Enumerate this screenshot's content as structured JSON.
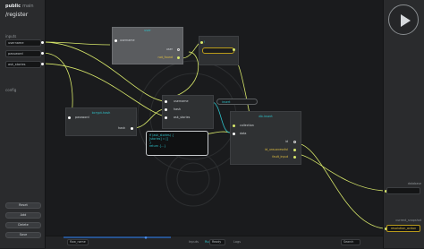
{
  "app": {
    "name": "public",
    "name_suffix": "main",
    "route": "/register"
  },
  "left": {
    "inputs_label": "inputs",
    "inputs": [
      {
        "value": "username"
      },
      {
        "value": "password"
      },
      {
        "value": "ask_stories"
      }
    ],
    "config_label": "config",
    "buttons": [
      "Reset",
      "Add",
      "Delete",
      "Save"
    ]
  },
  "right": {
    "outputs": [
      {
        "label": "database",
        "style": "default"
      },
      {
        "label": "current_snapshot",
        "value": "resolution_action",
        "style": "yellow"
      }
    ]
  },
  "nodes": {
    "user": {
      "title": "user",
      "inputs": [
        "username"
      ],
      "outputs": [
        "user",
        "not_found"
      ]
    },
    "not": {
      "title": "!"
    },
    "crypt": {
      "title": "bcrypt.hash",
      "inputs": [
        "password"
      ],
      "outputs": [
        "hash"
      ]
    },
    "create_user": {
      "title": "",
      "inputs": [
        "username",
        "hash",
        "ask_stories"
      ]
    },
    "insert": {
      "title": "",
      "value": "insert"
    },
    "dbinsert": {
      "title": "db.insert",
      "inputs": [
        "collection",
        "data"
      ],
      "outputs": [
        "id",
        "id_unsuccessful",
        "fault_input"
      ]
    },
    "code_lines": [
      "if (ask_stories) {",
      "  [stories] = []",
      "}",
      "return {...}"
    ]
  },
  "bottom": {
    "left_field": "flow_name",
    "segments": [
      "Inputs",
      "Run Mode",
      "Logs"
    ],
    "active_segment": 1,
    "right_field": "Search",
    "right_field_2": "Ready"
  },
  "colors": {
    "accent": "#2ec0c8",
    "wire": "#d8e86a",
    "yellow": "#e2c040"
  }
}
